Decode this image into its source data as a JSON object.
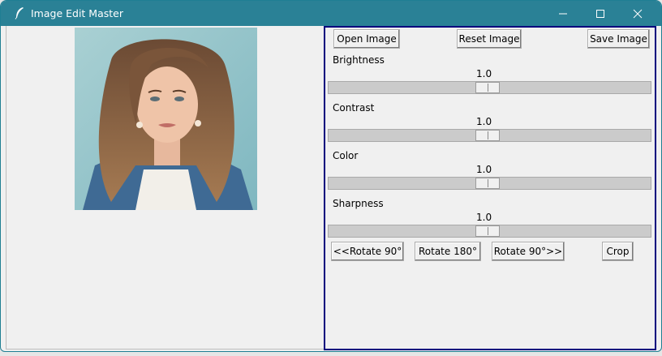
{
  "window": {
    "title": "Image Edit Master",
    "icon": "feather-icon",
    "controls": [
      "minimize-icon",
      "maximize-icon",
      "close-icon"
    ]
  },
  "image": {
    "description_visible": false
  },
  "toolbar": {
    "open_label": "Open Image",
    "reset_label": "Reset Image",
    "save_label": "Save Image"
  },
  "adjustments": [
    {
      "label": "Brightness",
      "value": "1.0",
      "fraction": 0.49
    },
    {
      "label": "Contrast",
      "value": "1.0",
      "fraction": 0.49
    },
    {
      "label": "Color",
      "value": "1.0",
      "fraction": 0.49
    },
    {
      "label": "Sharpness",
      "value": "1.0",
      "fraction": 0.49
    }
  ],
  "actions": {
    "rotate_left_label": "<<Rotate 90°",
    "rotate_180_label": "Rotate 180°",
    "rotate_right_label": "Rotate 90°>>",
    "crop_label": "Crop"
  },
  "colors": {
    "titlebar": "#2a8196",
    "panel_border": "#00007d"
  }
}
